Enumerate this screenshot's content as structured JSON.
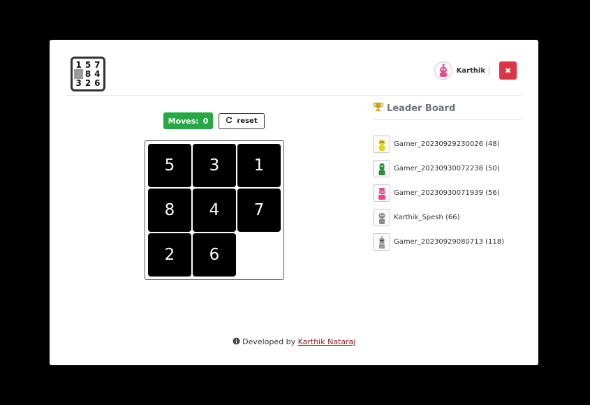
{
  "logo": {
    "cells": [
      "1",
      "5",
      "7",
      "",
      "8",
      "4",
      "3",
      "2",
      "6"
    ]
  },
  "user": {
    "name": "Karthik"
  },
  "close": {
    "label": "✖"
  },
  "moves": {
    "label": "Moves:",
    "count": "0"
  },
  "reset": {
    "label": "reset"
  },
  "board": {
    "tiles": [
      "5",
      "3",
      "1",
      "8",
      "4",
      "7",
      "2",
      "6",
      ""
    ]
  },
  "leaderboard": {
    "title": "Leader Board",
    "entries": [
      {
        "text": "Gamer_20230929230026 (48)",
        "avatar_color": "#e8d21a"
      },
      {
        "text": "Gamer_20230930072238 (50)",
        "avatar_color": "#2e8b3a"
      },
      {
        "text": "Gamer_20230930071939 (56)",
        "avatar_color": "#e64a8f"
      },
      {
        "text": "Karthik_Spesh (66)",
        "avatar_color": "#8a8a8a"
      },
      {
        "text": "Gamer_20230929080713 (118)",
        "avatar_color": "#9a9a9a"
      }
    ]
  },
  "footer": {
    "prefix": "Developed by",
    "link": "Karthik Nataraj"
  },
  "colors": {
    "moves_bg": "#28a745",
    "close_bg": "#dc3545",
    "tile_bg": "#000000",
    "trophy": "#d4a017"
  }
}
